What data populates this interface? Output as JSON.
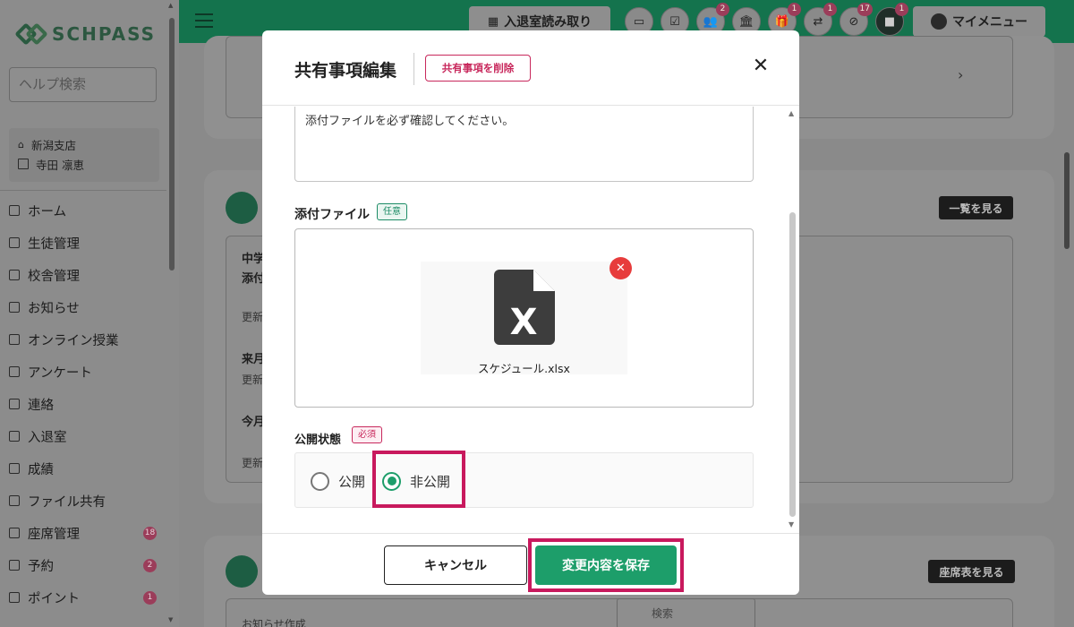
{
  "sidebar": {
    "logo_text": "SCHPASS",
    "help_search_placeholder": "ヘルプ検索",
    "branch": "新潟支店",
    "user": "寺田 凛恵",
    "items": [
      {
        "label": "ホーム",
        "badge": ""
      },
      {
        "label": "生徒管理",
        "badge": ""
      },
      {
        "label": "校舎管理",
        "badge": ""
      },
      {
        "label": "お知らせ",
        "badge": ""
      },
      {
        "label": "オンライン授業",
        "badge": ""
      },
      {
        "label": "アンケート",
        "badge": ""
      },
      {
        "label": "連絡",
        "badge": ""
      },
      {
        "label": "入退室",
        "badge": ""
      },
      {
        "label": "成績",
        "badge": ""
      },
      {
        "label": "ファイル共有",
        "badge": ""
      },
      {
        "label": "座席管理",
        "badge": "18"
      },
      {
        "label": "予約",
        "badge": "2"
      },
      {
        "label": "ポイント",
        "badge": "1"
      }
    ]
  },
  "header": {
    "scan_button": "入退室読み取り",
    "my_menu": "マイメニュー",
    "badges": [
      "",
      "",
      "2",
      "",
      "1",
      "1",
      "17",
      "1"
    ]
  },
  "background": {
    "view_all_button": "一覧を見る",
    "seat_button": "座席表を見る",
    "row1_line1": "中学",
    "row1_line2": "添付",
    "row_update": "更新",
    "row2": "来月",
    "row3": "今月",
    "bottom_sort": "お知らせ作成",
    "bottom_search": "検索"
  },
  "modal": {
    "title": "共有事項編集",
    "delete_button": "共有事項を削除",
    "body_text": "添付ファイルを必ず確認してください。",
    "attachment_label": "添付ファイル",
    "optional_tag": "任意",
    "file_name": "スケジュール.xlsx",
    "file_type_letter": "X",
    "status_label": "公開状態",
    "required_tag": "必須",
    "radio_public": "公開",
    "radio_private": "非公開",
    "selected_status": "非公開",
    "cancel_button": "キャンセル",
    "save_button": "変更内容を保存"
  },
  "colors": {
    "accent_green": "#1d9e6a",
    "highlight_magenta": "#c8195d",
    "danger_red": "#e73c3c"
  }
}
